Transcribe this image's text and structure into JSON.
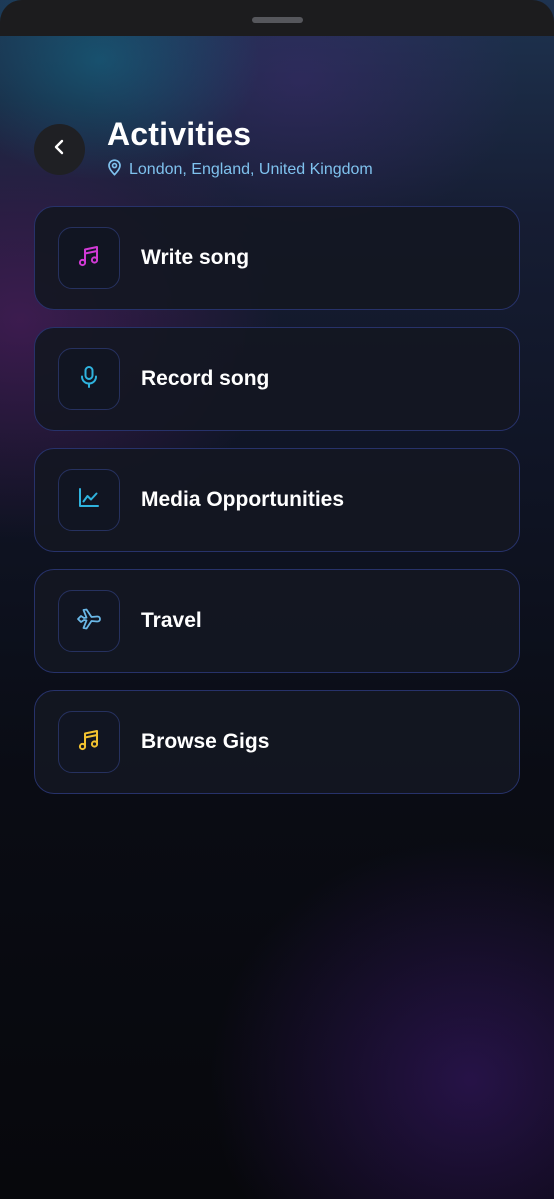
{
  "header": {
    "title": "Activities",
    "location": "London, England, United Kingdom",
    "back_icon": "chevron-left-icon",
    "location_icon": "map-pin-icon"
  },
  "activities": [
    {
      "label": "Write song",
      "icon": "music-note-icon",
      "icon_color": "#d23ad6"
    },
    {
      "label": "Record song",
      "icon": "microphone-icon",
      "icon_color": "#2fb3de"
    },
    {
      "label": "Media Opportunities",
      "icon": "line-chart-icon",
      "icon_color": "#2fb3de"
    },
    {
      "label": "Travel",
      "icon": "airplane-icon",
      "icon_color": "#6ab8e8"
    },
    {
      "label": "Browse Gigs",
      "icon": "music-note-icon",
      "icon_color": "#f2c230"
    }
  ],
  "colors": {
    "accent_location": "#7fc2ee",
    "card_border": "#27326a",
    "card_background": "#131722"
  }
}
